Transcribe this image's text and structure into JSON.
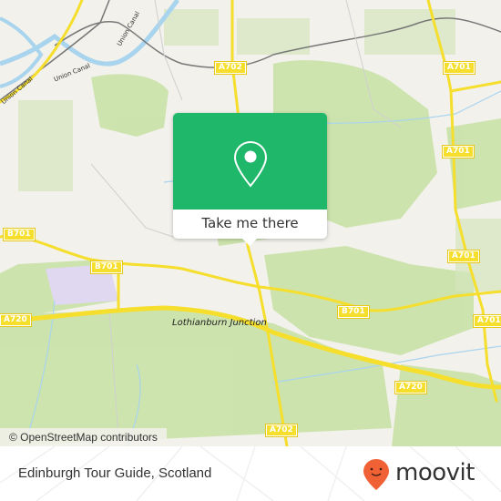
{
  "map": {
    "attribution": "© OpenStreetMap contributors",
    "place_labels": [
      {
        "text": "Lothianburn Junction"
      }
    ],
    "waterway_labels": [
      {
        "text": "Union Canal"
      },
      {
        "text": "Union Canal"
      },
      {
        "text": "Union Canal"
      }
    ],
    "road_labels": [
      {
        "text": "A702"
      },
      {
        "text": "A701"
      },
      {
        "text": "A701"
      },
      {
        "text": "B701"
      },
      {
        "text": "B701"
      },
      {
        "text": "B701"
      },
      {
        "text": "A701"
      },
      {
        "text": "A720"
      },
      {
        "text": "A701"
      },
      {
        "text": "A720"
      },
      {
        "text": "A702"
      }
    ],
    "colors": {
      "land": "#f2f1ec",
      "park": "#c9e2a7",
      "water": "#a9d4ee",
      "road": "#f5de2c",
      "rail": "#777777"
    }
  },
  "popup": {
    "icon": "map-pin-icon",
    "button_label": "Take me there",
    "color": "#1fb86a"
  },
  "footer": {
    "title": "Edinburgh Tour Guide, Scotland",
    "logo_text": "moovit",
    "logo_icon": "moovit-pin-icon",
    "logo_color": "#f06135"
  }
}
